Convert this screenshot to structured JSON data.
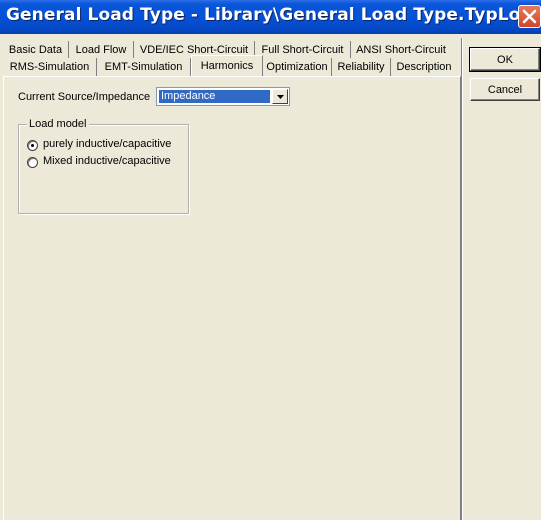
{
  "window": {
    "title": "General Load Type - Library\\General Load Type.TypLod *"
  },
  "tabs": {
    "row1": [
      "Basic Data",
      "Load Flow",
      "VDE/IEC Short-Circuit",
      "Full Short-Circuit",
      "ANSI Short-Circuit"
    ],
    "row2": [
      "RMS-Simulation",
      "EMT-Simulation",
      "Harmonics",
      "Optimization",
      "Reliability",
      "Description"
    ],
    "active": "Harmonics"
  },
  "harmonics": {
    "current_source_label": "Current Source/Impedance",
    "current_source_value": "Impedance",
    "load_model": {
      "title": "Load model",
      "options": [
        "purely inductive/capacitive",
        "Mixed inductive/capacitive"
      ],
      "selected": "purely inductive/capacitive"
    }
  },
  "buttons": {
    "ok": "OK",
    "cancel": "Cancel"
  },
  "icons": {
    "close": "close-icon",
    "dropdown": "chevron-down-icon"
  }
}
